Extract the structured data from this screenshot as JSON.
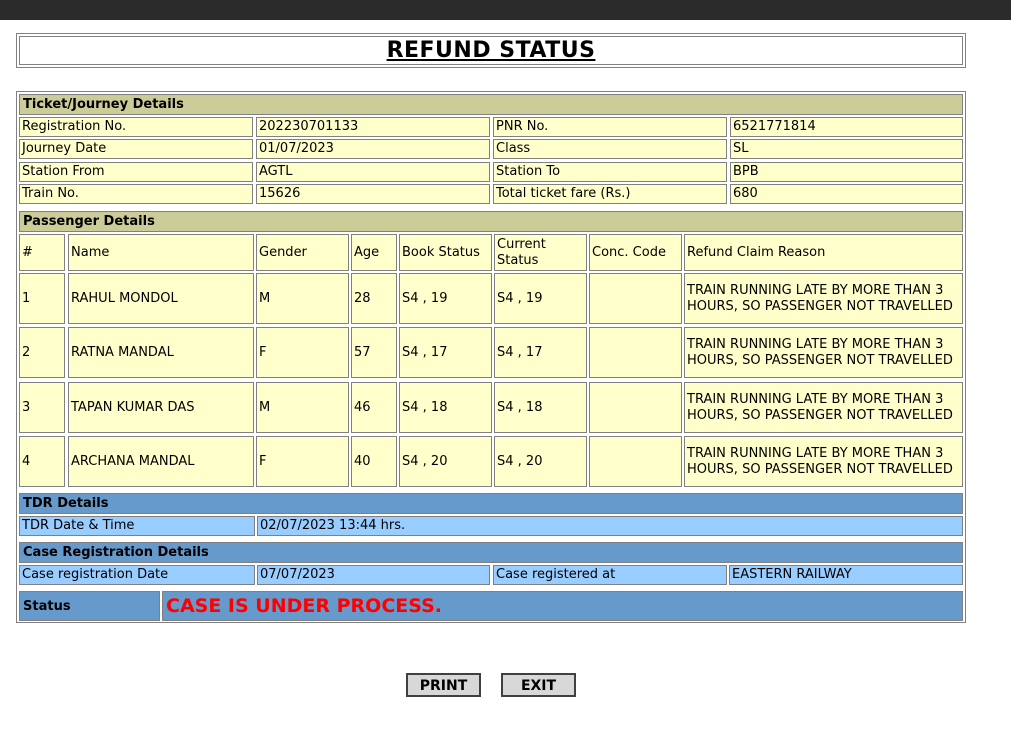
{
  "page_title": "REFUND STATUS",
  "ticket": {
    "section_label": "Ticket/Journey Details",
    "rows": [
      {
        "l1": "Registration No.",
        "v1": "202230701133",
        "l2": "PNR No.",
        "v2": "6521771814"
      },
      {
        "l1": "Journey Date",
        "v1": "01/07/2023",
        "l2": "Class",
        "v2": "SL"
      },
      {
        "l1": "Station From",
        "v1": "AGTL",
        "l2": "Station To",
        "v2": "BPB"
      },
      {
        "l1": "Train No.",
        "v1": "15626",
        "l2": "Total ticket fare (Rs.)",
        "v2": "680"
      }
    ]
  },
  "passengers": {
    "section_label": "Passenger Details",
    "headers": [
      "#",
      "Name",
      "Gender",
      "Age",
      "Book Status",
      "Current Status",
      "Conc. Code",
      "Refund Claim Reason"
    ],
    "rows": [
      [
        "1",
        "RAHUL MONDOL",
        "M",
        "28",
        "S4 , 19",
        "S4 , 19",
        "",
        "TRAIN RUNNING LATE BY MORE THAN 3 HOURS, SO PASSENGER NOT TRAVELLED"
      ],
      [
        "2",
        "RATNA MANDAL",
        "F",
        "57",
        "S4 , 17",
        "S4 , 17",
        "",
        "TRAIN RUNNING LATE BY MORE THAN 3 HOURS, SO PASSENGER NOT TRAVELLED"
      ],
      [
        "3",
        "TAPAN KUMAR DAS",
        "M",
        "46",
        "S4 , 18",
        "S4 , 18",
        "",
        "TRAIN RUNNING LATE BY MORE THAN 3 HOURS, SO PASSENGER NOT TRAVELLED"
      ],
      [
        "4",
        "ARCHANA MANDAL",
        "F",
        "40",
        "S4 , 20",
        "S4 , 20",
        "",
        "TRAIN RUNNING LATE BY MORE THAN 3 HOURS, SO PASSENGER NOT TRAVELLED"
      ]
    ]
  },
  "tdr": {
    "section_label": "TDR Details",
    "date_label": "TDR Date & Time",
    "date_value": "02/07/2023 13:44 hrs."
  },
  "case": {
    "section_label": "Case Registration Details",
    "date_label": "Case registration Date",
    "date_value": "07/07/2023",
    "at_label": "Case registered at",
    "at_value": "EASTERN RAILWAY"
  },
  "status": {
    "label": "Status",
    "value": "CASE IS UNDER PROCESS."
  },
  "buttons": {
    "print": "PRINT",
    "exit": "EXIT"
  },
  "colors": {
    "olive_header": "#cccc99",
    "cell_yellow": "#ffffcc",
    "blue_header": "#6699cc",
    "light_blue_cell": "#99ccff",
    "status_red": "#ff0000"
  }
}
